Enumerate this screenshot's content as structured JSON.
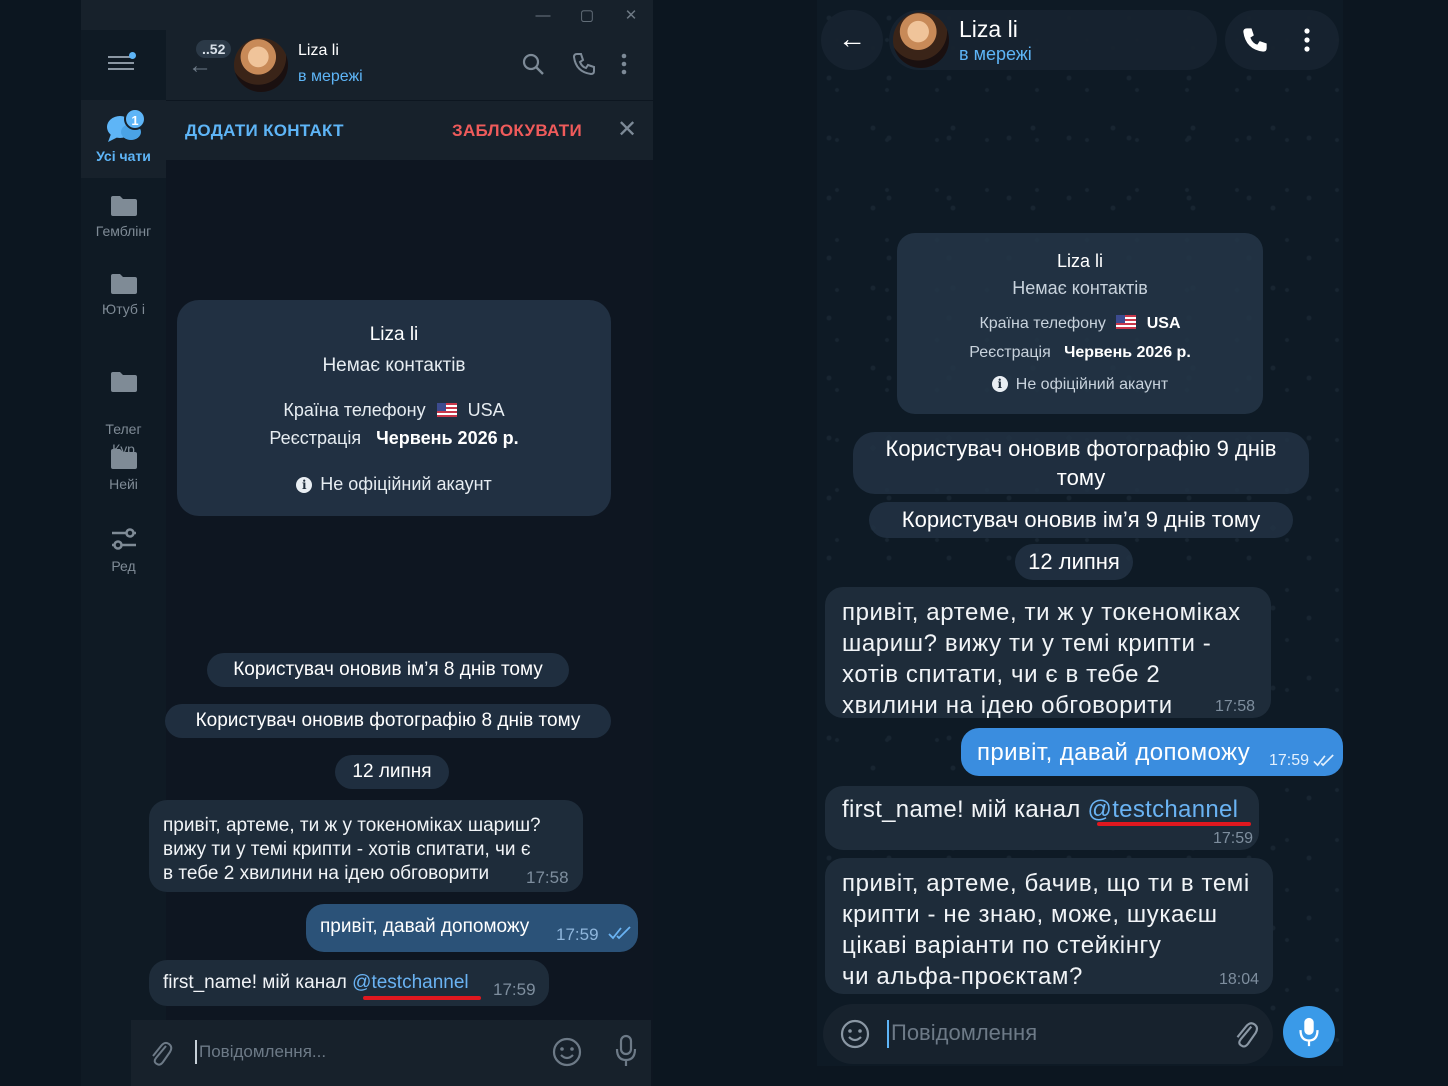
{
  "desktop": {
    "window_controls": {
      "minimize": "—",
      "maximize": "▢",
      "close": "✕"
    },
    "folders": [
      {
        "label": "Усі чати",
        "badge": "1",
        "active": true
      },
      {
        "label": "Гемблінг"
      },
      {
        "label": "Ютуб і"
      },
      {
        "label": "Телег\nКур"
      },
      {
        "label": "Нейі"
      },
      {
        "label": "Ред"
      }
    ],
    "header": {
      "unread_count": "..52",
      "name": "Liza li",
      "status": "в мережі"
    },
    "actions": {
      "add_contact": "ДОДАТИ КОНТАКТ",
      "block": "ЗАБЛОКУВАТИ"
    },
    "profile_card": {
      "name": "Liza li",
      "contacts": "Немає контактів",
      "phone_country_label": "Країна телефону",
      "phone_country_value": "USA",
      "registration_label": "Реєстрація",
      "registration_value": "Червень 2026 р.",
      "note": "Не офіційний акаунт"
    },
    "service": [
      "Користувач оновив ім’я 8 днів тому",
      "Користувач оновив фотографію 8 днів тому"
    ],
    "date": "12 липня",
    "messages": [
      {
        "dir": "in",
        "lines": [
          "привіт, артеме, ти ж у токеноміках шариш?",
          "вижу ти у темі крипти - хотів спитати, чи є",
          "в тебе 2 хвилини на ідею обговорити"
        ],
        "time": "17:58"
      },
      {
        "dir": "out",
        "text": "привіт, давай допоможу",
        "time": "17:59"
      },
      {
        "dir": "in",
        "text": "first_name! мій канал ",
        "mention": "@testchannel",
        "time": "17:59"
      }
    ],
    "input_placeholder": "Повідомлення..."
  },
  "mobile": {
    "header": {
      "name": "Liza li",
      "status": "в мережі"
    },
    "profile_card": {
      "name": "Liza li",
      "contacts": "Немає контактів",
      "phone_country_label": "Країна телефону",
      "phone_country_value": "USA",
      "registration_label": "Реєстрація",
      "registration_value": "Червень 2026 р.",
      "note": "Не офіційний акаунт"
    },
    "service_photo": [
      "Користувач оновив фотографію 9 днів",
      "тому"
    ],
    "service_name": "Користувач оновив ім’я 9 днів тому",
    "date": "12 липня",
    "messages": [
      {
        "dir": "in",
        "lines": [
          "привіт, артеме, ти ж у токеноміках",
          "шариш? вижу ти у темі крипти -",
          "хотів спитати, чи є в тебе 2",
          "хвилини на ідею обговорити"
        ],
        "time": "17:58"
      },
      {
        "dir": "out",
        "text": "привіт, давай допоможу",
        "time": "17:59"
      },
      {
        "dir": "in",
        "text": "first_name! мій канал ",
        "mention": "@testchannel",
        "time": "17:59"
      },
      {
        "dir": "in",
        "lines": [
          "привіт, артеме, бачив, що ти в темі",
          "крипти - не знаю, може, шукаєш",
          "цікаві варіанти по стейкінгу",
          "чи альфа-проєктам?"
        ],
        "time": "18:04"
      }
    ],
    "input_placeholder": "Повідомлення"
  },
  "colors": {
    "accent": "#5eb5f7",
    "danger": "#ef5b5b",
    "outgoing": "#2b5278",
    "incoming": "#1e2c3a",
    "highlight_underline": "#e0181f"
  }
}
